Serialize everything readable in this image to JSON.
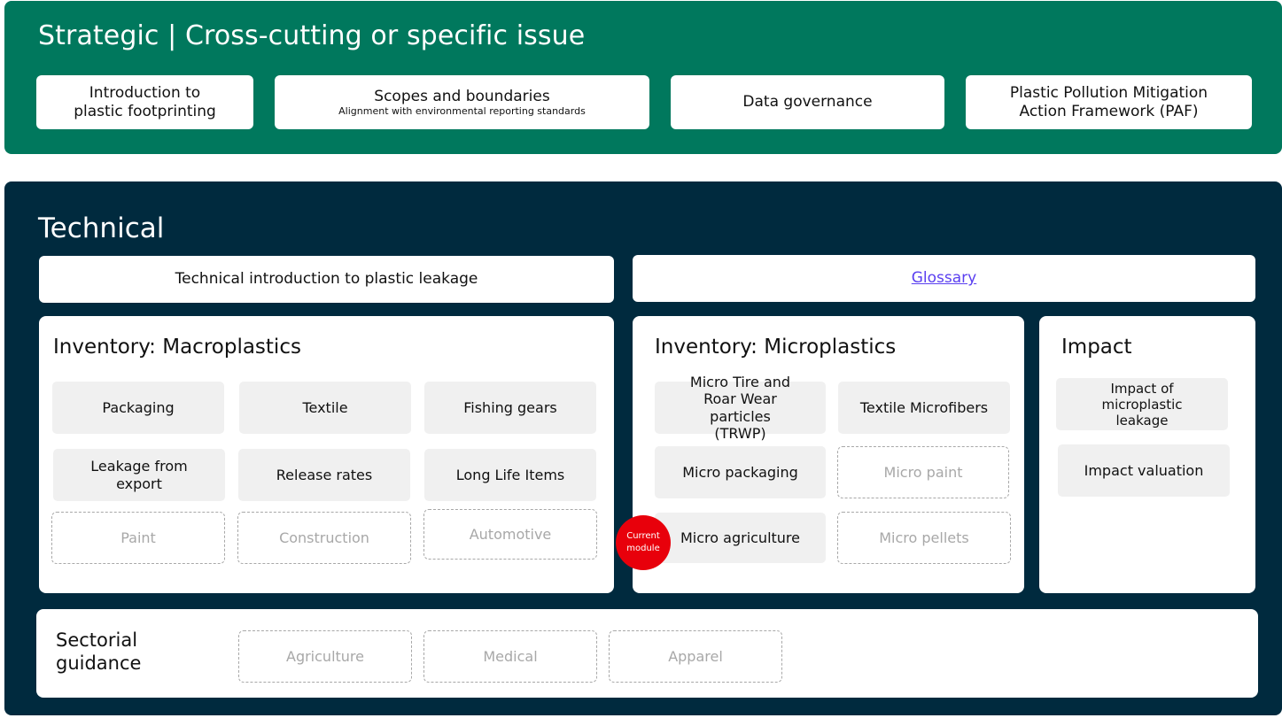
{
  "strategic": {
    "title": "Strategic | Cross-cutting or specific issue",
    "items": [
      {
        "line1": "Introduction to",
        "line2": "plastic footprinting"
      },
      {
        "line1": "Scopes and boundaries",
        "sub": "Alignment with environmental reporting standards"
      },
      {
        "line1": "Data governance"
      },
      {
        "line1": "Plastic Pollution Mitigation",
        "line2": "Action Framework  (PAF)"
      }
    ]
  },
  "technical": {
    "title": "Technical",
    "intro_label": "Technical introduction to plastic leakage",
    "glossary_label": "Glossary",
    "macro": {
      "title": "Inventory: Macroplastics",
      "modules": [
        {
          "label": "Packaging",
          "status": "available"
        },
        {
          "label": "Textile",
          "status": "available"
        },
        {
          "label": "Fishing gears",
          "status": "available"
        },
        {
          "label": "Leakage from export",
          "status": "available"
        },
        {
          "label": "Release rates",
          "status": "available"
        },
        {
          "label": "Long Life Items",
          "status": "available"
        },
        {
          "label": "Paint",
          "status": "unavailable"
        },
        {
          "label": "Construction",
          "status": "unavailable"
        },
        {
          "label": "Automotive",
          "status": "unavailable"
        }
      ]
    },
    "micro": {
      "title": "Inventory: Microplastics",
      "modules": [
        {
          "label": "Micro Tire and Roar Wear particles (TRWP)",
          "status": "available"
        },
        {
          "label": "Textile Microfibers",
          "status": "available"
        },
        {
          "label": "Micro packaging",
          "status": "available"
        },
        {
          "label": "Micro paint",
          "status": "unavailable"
        },
        {
          "label": "Micro agriculture",
          "status": "current"
        },
        {
          "label": "Micro pellets",
          "status": "unavailable"
        }
      ],
      "current_badge": {
        "line1": "Current",
        "line2": "module"
      }
    },
    "impact": {
      "title": "Impact",
      "modules": [
        {
          "label": "Impact of microplastic leakage",
          "status": "available"
        },
        {
          "label": "Impact valuation",
          "status": "available"
        }
      ]
    },
    "sectorial": {
      "title_line1": "Sectorial",
      "title_line2": "guidance",
      "modules": [
        {
          "label": "Agriculture",
          "status": "unavailable"
        },
        {
          "label": "Medical",
          "status": "unavailable"
        },
        {
          "label": "Apparel",
          "status": "unavailable"
        }
      ]
    }
  },
  "colors": {
    "strategic_bg": "#00785d",
    "technical_bg": "#002a3e",
    "module_bg": "#f0f0f0",
    "inactive_text": "#a8a8a8",
    "current_badge": "#e8000b",
    "link": "#5a3ff0"
  }
}
